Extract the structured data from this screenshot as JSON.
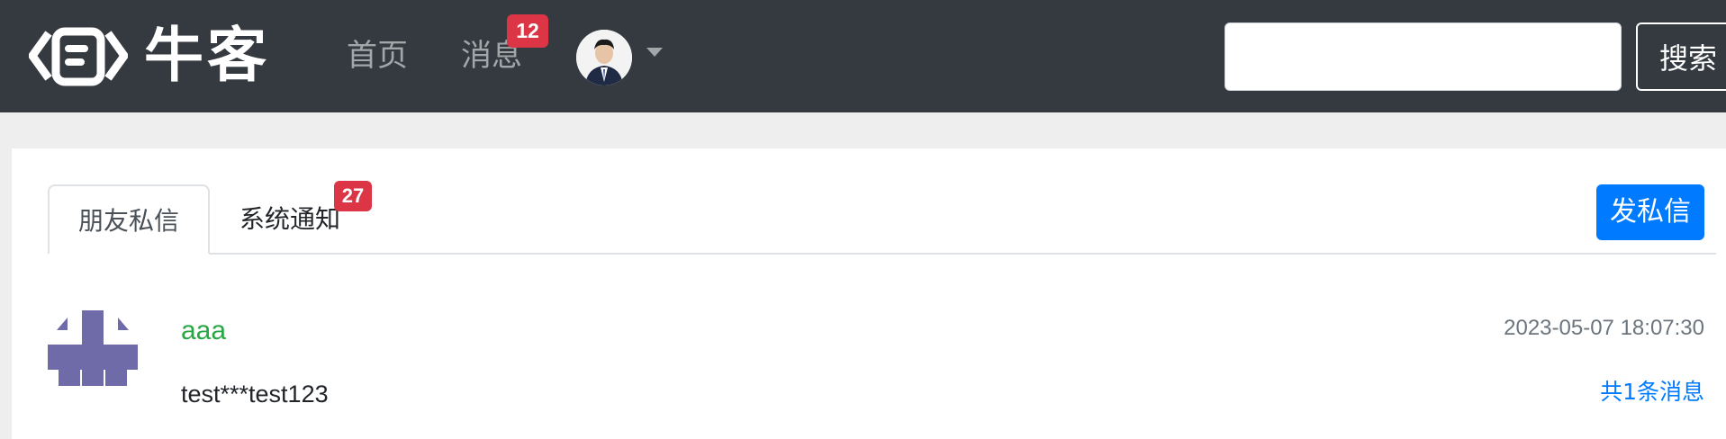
{
  "navbar": {
    "brand_text": "牛客",
    "links": {
      "home": "首页",
      "messages": "消息"
    },
    "messages_badge": "12",
    "search": {
      "placeholder": "",
      "button": "搜索"
    },
    "colors": {
      "background": "#343a40",
      "badge": "#dc3545"
    }
  },
  "panel": {
    "tabs": {
      "friends": "朋友私信",
      "system": "系统通知"
    },
    "system_badge": "27",
    "send_button": "发私信",
    "conversations": [
      {
        "username": "aaa",
        "time": "2023-05-07 18:07:30",
        "preview": "test***test123",
        "count": "共1条消息"
      }
    ],
    "colors": {
      "accent": "#007bff",
      "username": "#28a745",
      "avatar": "#6f6aa8"
    }
  }
}
